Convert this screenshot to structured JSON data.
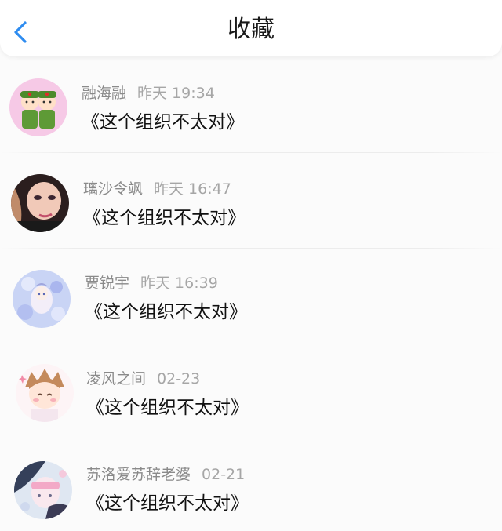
{
  "header": {
    "title": "收藏",
    "back_icon": "chevron-left-icon",
    "accent_color": "#2e8cf0"
  },
  "items": [
    {
      "user": "融海融",
      "time": "昨天 19:34",
      "content": "《这个组织不太对》"
    },
    {
      "user": "璃沙令飒",
      "time": "昨天 16:47",
      "content": "《这个组织不太对》"
    },
    {
      "user": "贾锐宇",
      "time": "昨天 16:39",
      "content": "《这个组织不太对》"
    },
    {
      "user": "凌风之间",
      "time": "02-23",
      "content": "《这个组织不太对》"
    },
    {
      "user": "苏洛爱苏辞老婆",
      "time": "02-21",
      "content": "《这个组织不太对》"
    }
  ]
}
